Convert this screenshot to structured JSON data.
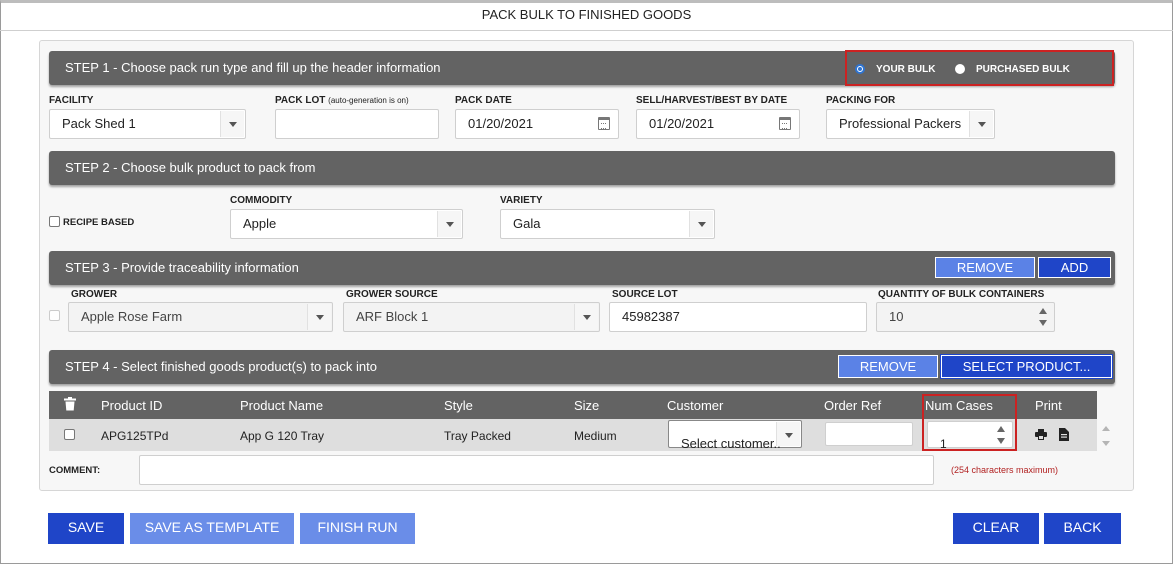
{
  "window": {
    "title": "PACK BULK TO FINISHED GOODS"
  },
  "step1": {
    "heading": "STEP 1 - Choose pack run type and fill up the header information",
    "radio_your_bulk": "YOUR BULK",
    "radio_purchased_bulk": "PURCHASED BULK",
    "facility_label": "FACILITY",
    "facility_value": "Pack Shed 1",
    "pack_lot_label": "PACK LOT",
    "pack_lot_note": "(auto-generation is on)",
    "pack_lot_value": "",
    "pack_date_label": "PACK DATE",
    "pack_date_value": "01/20/2021",
    "sell_date_label": "SELL/HARVEST/BEST BY DATE",
    "sell_date_value": "01/20/2021",
    "packing_for_label": "PACKING FOR",
    "packing_for_value": "Professional Packers"
  },
  "step2": {
    "heading": "STEP 2 - Choose bulk product to pack from",
    "recipe_label": "RECIPE BASED",
    "commodity_label": "COMMODITY",
    "commodity_value": "Apple",
    "variety_label": "VARIETY",
    "variety_value": "Gala"
  },
  "step3": {
    "heading": "STEP 3 - Provide traceability information",
    "remove_label": "REMOVE",
    "add_label": "ADD",
    "grower_label": "GROWER",
    "grower_value": "Apple Rose Farm",
    "grower_source_label": "GROWER SOURCE",
    "grower_source_value": "ARF Block 1",
    "source_lot_label": "SOURCE LOT",
    "source_lot_value": "45982387",
    "qty_label": "QUANTITY OF BULK CONTAINERS",
    "qty_value": "10"
  },
  "step4": {
    "heading": "STEP 4 - Select finished goods product(s) to pack into",
    "remove_label": "REMOVE",
    "select_label": "SELECT PRODUCT...",
    "columns": {
      "product_id": "Product ID",
      "product_name": "Product Name",
      "style": "Style",
      "size": "Size",
      "customer": "Customer",
      "order_ref": "Order Ref",
      "num_cases": "Num Cases",
      "print": "Print"
    },
    "row": {
      "product_id": "APG125TPd",
      "product_name": "App G 120 Tray",
      "style": "Tray Packed",
      "size": "Medium",
      "customer": "Select customer..",
      "order_ref": "",
      "num_cases": "1"
    },
    "comment_label": "COMMENT:",
    "comment_value": "",
    "comment_note": "(254 characters maximum)"
  },
  "actions": {
    "save": "SAVE",
    "save_template": "SAVE AS TEMPLATE",
    "finish": "FINISH RUN",
    "clear": "CLEAR",
    "back": "BACK"
  },
  "colors": {
    "bar": "#636363",
    "accent_blue": "#1f45c8",
    "highlight_red": "#cc2222",
    "note_red": "#b22222"
  }
}
